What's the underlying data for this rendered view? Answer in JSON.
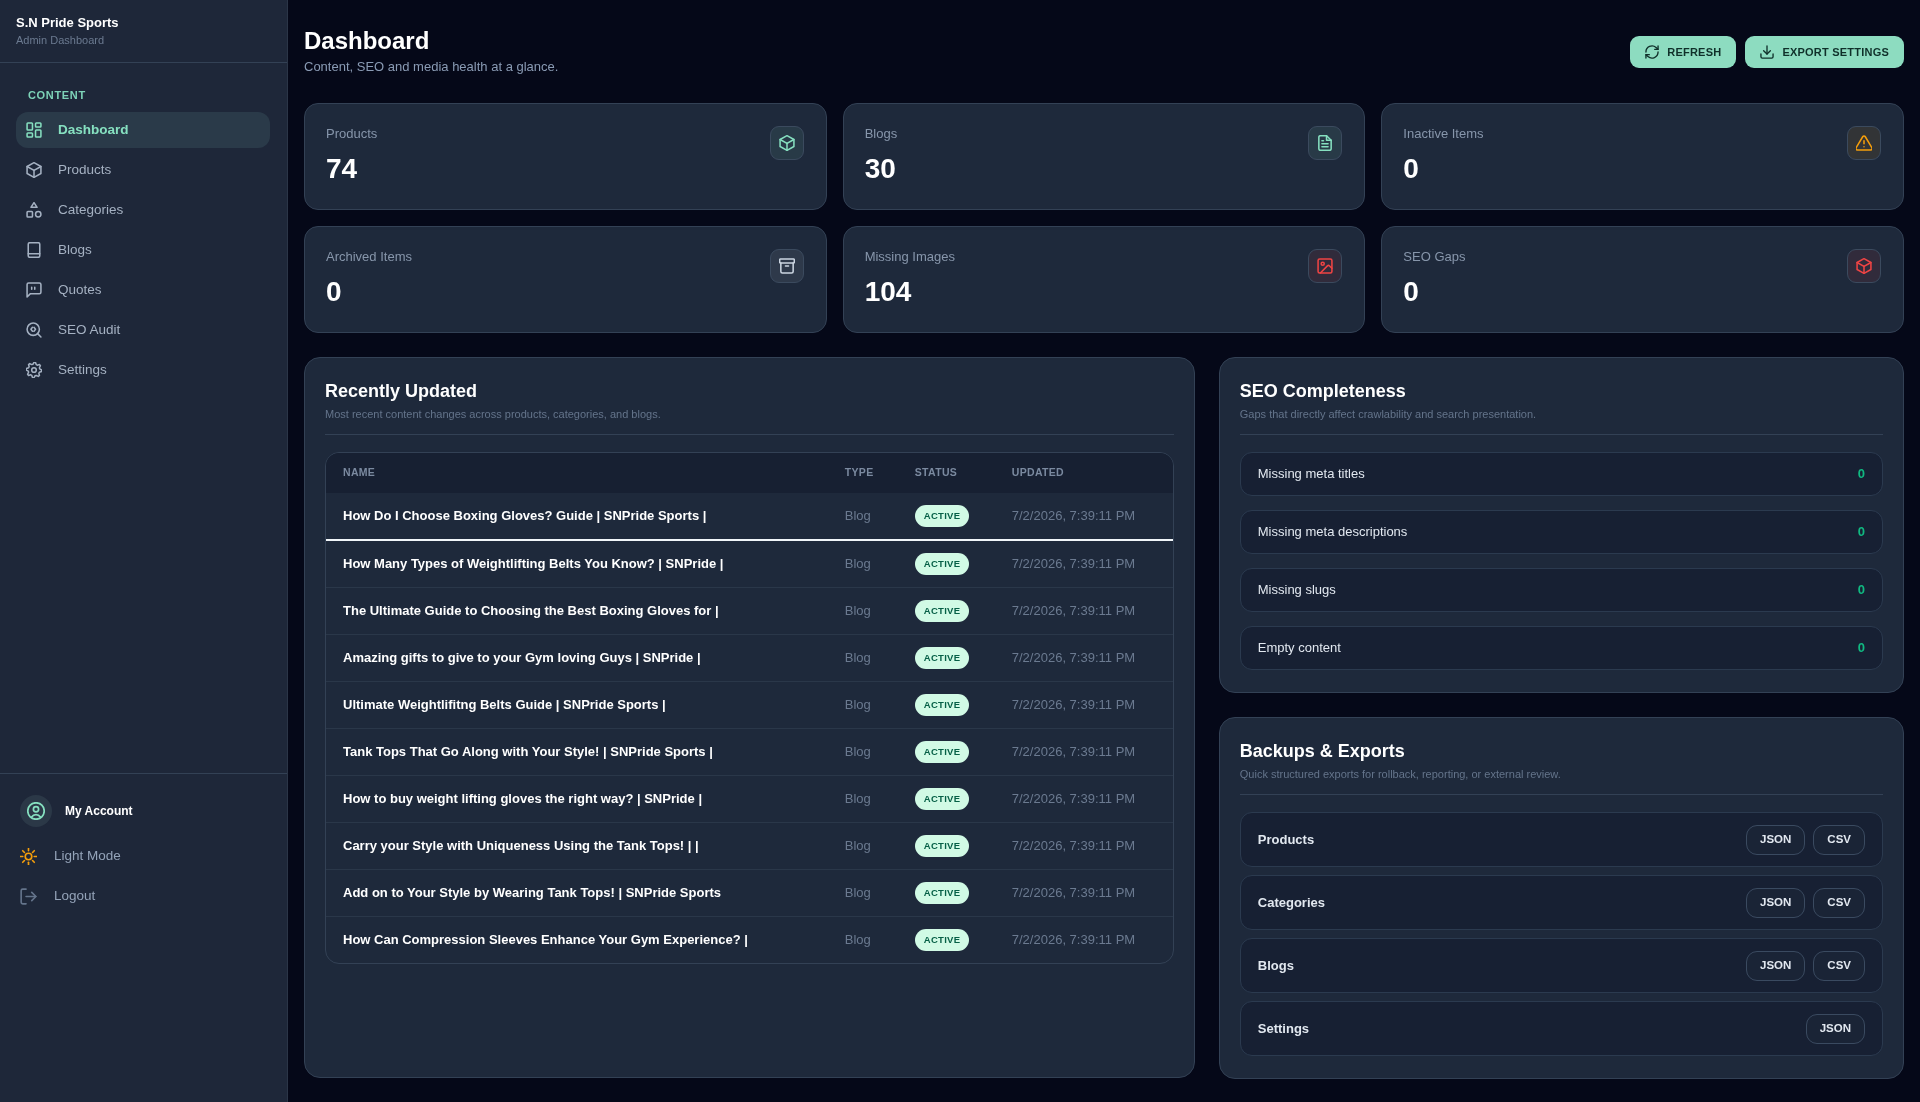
{
  "sidebar": {
    "brand": "S.N Pride Sports",
    "subtitle": "Admin Dashboard",
    "section_label": "CONTENT",
    "items": [
      {
        "label": "Dashboard",
        "selected": true
      },
      {
        "label": "Products",
        "selected": false
      },
      {
        "label": "Categories",
        "selected": false
      },
      {
        "label": "Blogs",
        "selected": false
      },
      {
        "label": "Quotes",
        "selected": false
      },
      {
        "label": "SEO Audit",
        "selected": false
      },
      {
        "label": "Settings",
        "selected": false
      }
    ],
    "account": "My Account",
    "footer_items": [
      "Light Mode",
      "Logout"
    ]
  },
  "header": {
    "title": "Dashboard",
    "subtitle": "Content, SEO and media health at a glance.",
    "buttons": [
      "REFRESH",
      "EXPORT SETTINGS"
    ]
  },
  "stats": [
    {
      "label": "Products",
      "value": "74",
      "color": "#86e0c0"
    },
    {
      "label": "Blogs",
      "value": "30",
      "color": "#86e0c0"
    },
    {
      "label": "Inactive Items",
      "value": "0",
      "color": "#f59e0b"
    },
    {
      "label": "Archived Items",
      "value": "0",
      "color": "#cbd5e1"
    },
    {
      "label": "Missing Images",
      "value": "104",
      "color": "#ef4444"
    },
    {
      "label": "SEO Gaps",
      "value": "0",
      "color": "#ef4444"
    }
  ],
  "recently_updated": {
    "title": "Recently Updated",
    "subtitle": "Most recent content changes across products, categories, and blogs.",
    "table": {
      "columns": [
        "NAME",
        "TYPE",
        "STATUS",
        "UPDATED"
      ],
      "rows": [
        {
          "name": "How Do I Choose Boxing Gloves? Guide | SNPride Sports |",
          "type": "Blog",
          "status": "ACTIVE",
          "updated": "7/2/2026, 7:39:11 PM",
          "selected": true
        },
        {
          "name": "How Many Types of Weightlifting Belts You Know? | SNPride |",
          "type": "Blog",
          "status": "ACTIVE",
          "updated": "7/2/2026, 7:39:11 PM",
          "selected": false
        },
        {
          "name": "The Ultimate Guide to Choosing the Best Boxing Gloves for |",
          "type": "Blog",
          "status": "ACTIVE",
          "updated": "7/2/2026, 7:39:11 PM",
          "selected": false
        },
        {
          "name": "Amazing gifts to give to your Gym loving Guys | SNPride |",
          "type": "Blog",
          "status": "ACTIVE",
          "updated": "7/2/2026, 7:39:11 PM",
          "selected": false
        },
        {
          "name": "Ultimate Weightlifitng Belts Guide | SNPride Sports |",
          "type": "Blog",
          "status": "ACTIVE",
          "updated": "7/2/2026, 7:39:11 PM",
          "selected": false
        },
        {
          "name": "Tank Tops That Go Along with Your Style! | SNPride Sports |",
          "type": "Blog",
          "status": "ACTIVE",
          "updated": "7/2/2026, 7:39:11 PM",
          "selected": false
        },
        {
          "name": "How to buy weight lifting gloves the right way? | SNPride |",
          "type": "Blog",
          "status": "ACTIVE",
          "updated": "7/2/2026, 7:39:11 PM",
          "selected": false
        },
        {
          "name": "Carry your Style with Uniqueness Using the Tank Tops! | |",
          "type": "Blog",
          "status": "ACTIVE",
          "updated": "7/2/2026, 7:39:11 PM",
          "selected": false
        },
        {
          "name": "Add on to Your Style by Wearing Tank Tops! | SNPride Sports",
          "type": "Blog",
          "status": "ACTIVE",
          "updated": "7/2/2026, 7:39:11 PM",
          "selected": false
        },
        {
          "name": "How Can Compression Sleeves Enhance Your Gym Experience? |",
          "type": "Blog",
          "status": "ACTIVE",
          "updated": "7/2/2026, 7:39:11 PM",
          "selected": false
        }
      ]
    }
  },
  "seo_completeness": {
    "title": "SEO Completeness",
    "subtitle": "Gaps that directly affect crawlability and search presentation.",
    "items": [
      {
        "label": "Missing meta titles",
        "value": "0"
      },
      {
        "label": "Missing meta descriptions",
        "value": "0"
      },
      {
        "label": "Missing slugs",
        "value": "0"
      },
      {
        "label": "Empty content",
        "value": "0"
      }
    ]
  },
  "backups": {
    "title": "Backups & Exports",
    "subtitle": "Quick structured exports for rollback, reporting, or external review.",
    "rows": [
      {
        "label": "Products",
        "buttons": [
          "JSON",
          "CSV"
        ]
      },
      {
        "label": "Categories",
        "buttons": [
          "JSON",
          "CSV"
        ]
      },
      {
        "label": "Blogs",
        "buttons": [
          "JSON",
          "CSV"
        ]
      },
      {
        "label": "Settings",
        "buttons": [
          "JSON"
        ]
      }
    ]
  }
}
